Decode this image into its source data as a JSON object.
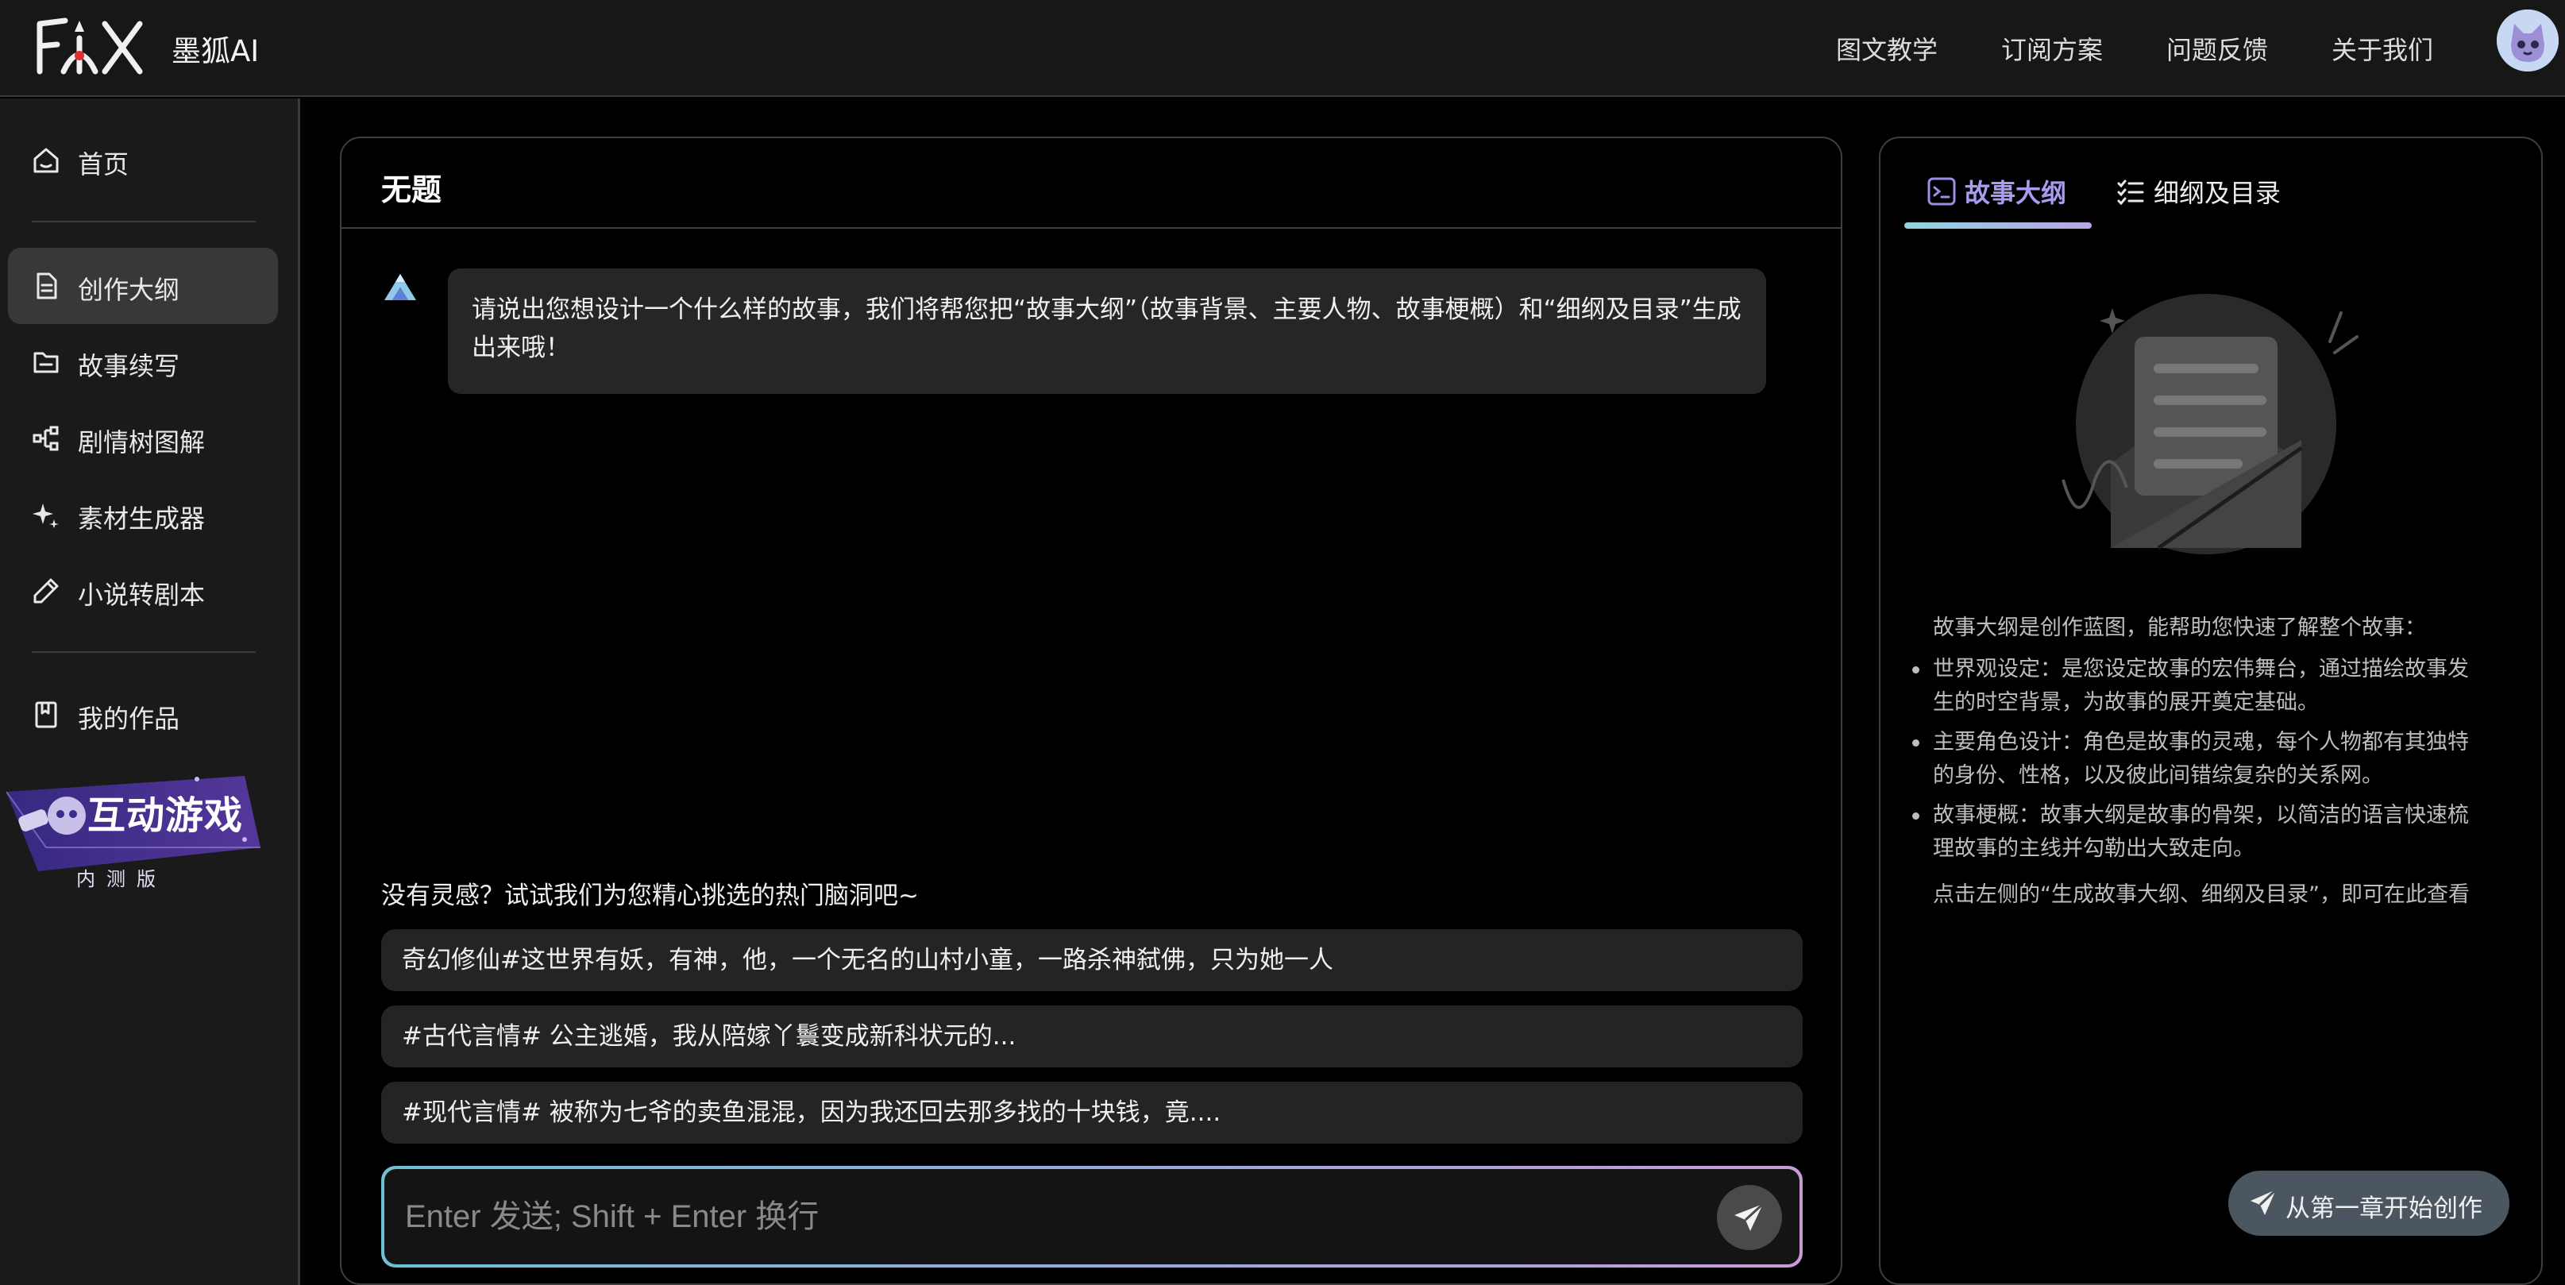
{
  "header": {
    "brand": "墨狐AI",
    "nav": [
      "图文教学",
      "订阅方案",
      "问题反馈",
      "关于我们"
    ]
  },
  "sidebar": {
    "items": [
      {
        "label": "首页",
        "icon": "home-icon"
      },
      {
        "label": "创作大纲",
        "icon": "document-icon",
        "active": true
      },
      {
        "label": "故事续写",
        "icon": "folder-icon"
      },
      {
        "label": "剧情树图解",
        "icon": "tree-icon"
      },
      {
        "label": "素材生成器",
        "icon": "sparkle-icon"
      },
      {
        "label": "小说转剧本",
        "icon": "pencil-icon"
      },
      {
        "label": "我的作品",
        "icon": "bookmark-icon"
      }
    ],
    "game_banner": {
      "title": "互动游戏",
      "subtitle": "内测版"
    }
  },
  "chat": {
    "title": "无题",
    "bot_message": "请说出您想设计一个什么样的故事，我们将帮您把“故事大纲”（故事背景、主要人物、故事梗概）和“细纲及目录”生成出来哦！",
    "hint": "没有灵感？试试我们为您精心挑选的热门脑洞吧~",
    "suggestions": [
      "奇幻修仙#这世界有妖，有神，他，一个无名的山村小童，一路杀神弑佛，只为她一人",
      "#古代言情# 公主逃婚，我从陪嫁丫鬟变成新科状元的...",
      "#现代言情# 被称为七爷的卖鱼混混，因为我还回去那多找的十块钱，竟...."
    ],
    "input_placeholder": "Enter 发送; Shift + Enter 换行"
  },
  "right_panel": {
    "tabs": [
      {
        "label": "故事大纲",
        "active": true
      },
      {
        "label": "细纲及目录",
        "active": false
      }
    ],
    "intro": "故事大纲是创作蓝图，能帮助您快速了解整个故事：",
    "points": [
      "世界观设定：是您设定故事的宏伟舞台，通过描绘故事发生的时空背景，为故事的展开奠定基础。",
      "主要角色设计：角色是故事的灵魂，每个人物都有其独特的身份、性格，以及彼此间错综复杂的关系网。",
      "故事梗概：故事大纲是故事的骨架，以简洁的语言快速梳理故事的主线并勾勒出大致走向。"
    ],
    "footer": "点击左侧的“生成故事大纲、细纲及目录”，即可在此查看",
    "start_button": "从第一章开始创作"
  },
  "colors": {
    "accent_tab": "#9a8fe6",
    "input_gradient": [
      "#6fc0d2",
      "#c79bd6"
    ],
    "sidebar_active": "#383838"
  }
}
